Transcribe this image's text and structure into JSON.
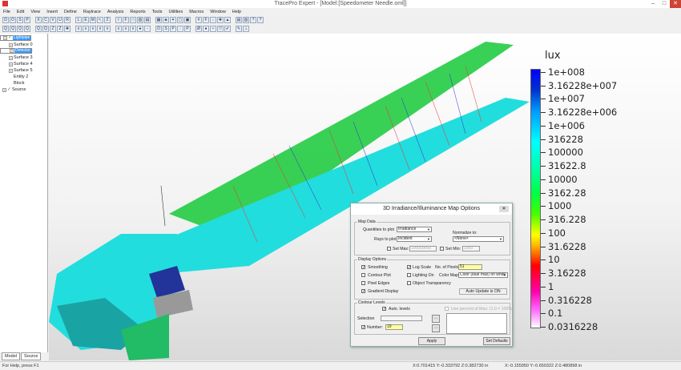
{
  "window": {
    "title": "TracePro Expert - [Model:[Speedometer Needle.oml]]",
    "minimize": "–",
    "maximize": "□",
    "close": "✕"
  },
  "menu": [
    "File",
    "Edit",
    "View",
    "Insert",
    "Define",
    "Raytrace",
    "Analysis",
    "Reports",
    "Tools",
    "Utilities",
    "Macros",
    "Window",
    "Help"
  ],
  "toolbar1": [
    "D",
    "O",
    "S",
    "P",
    "X",
    "C",
    "V",
    "U",
    "R",
    "L",
    "E",
    "M",
    "↖",
    "Z",
    "I",
    "F",
    "□",
    "▥",
    "▤",
    "▦",
    "◈",
    "✦",
    "▢",
    "▣",
    "#",
    "F",
    "↓",
    "✚",
    "▲",
    "▤",
    "▥",
    "?",
    "?"
  ],
  "toolbar2": [
    "Q",
    "Q",
    "Q",
    "Q",
    "Q",
    "Q",
    "Z",
    "Z",
    "✚",
    "x",
    "x",
    "x",
    "x",
    "x",
    "x",
    "x",
    "x",
    "●",
    "-",
    "D",
    "S",
    "P",
    ":",
    "P",
    "Ø",
    "●",
    "•",
    "▽",
    "✔",
    "✎",
    "⊥"
  ],
  "tree": [
    {
      "label": "Lightpipe",
      "expander": "+",
      "checked": true,
      "selected": true,
      "indent": 0
    },
    {
      "label": "Detector",
      "expander": "-",
      "checked": true,
      "selected": false,
      "indent": 0
    },
    {
      "label": "Surface 0",
      "expander": "+",
      "checked": false,
      "selected": false,
      "indent": 1
    },
    {
      "label": "Detector",
      "expander": "+",
      "checked": false,
      "selected": true,
      "indent": 1
    },
    {
      "label": "Surface 2",
      "expander": "+",
      "checked": false,
      "selected": false,
      "indent": 1
    },
    {
      "label": "Surface 3",
      "expander": "+",
      "checked": false,
      "selected": false,
      "indent": 1
    },
    {
      "label": "Surface 4",
      "expander": "+",
      "checked": false,
      "selected": false,
      "indent": 1
    },
    {
      "label": "Surface 5",
      "expander": "+",
      "checked": false,
      "selected": false,
      "indent": 1
    },
    {
      "label": "Entity 2",
      "expander": "",
      "checked": false,
      "selected": false,
      "indent": 1
    },
    {
      "label": "Block",
      "expander": "",
      "checked": false,
      "selected": false,
      "indent": 1
    },
    {
      "label": "Source",
      "expander": "+",
      "checked": true,
      "selected": false,
      "indent": 0
    }
  ],
  "tabs": [
    "Model",
    "Source"
  ],
  "legend": {
    "unit": "lux",
    "labels": [
      "1e+008",
      "3.16228e+007",
      "1e+007",
      "3.16228e+006",
      "1e+006",
      "316228",
      "100000",
      "31622.8",
      "10000",
      "3162.28",
      "1000",
      "316.228",
      "100",
      "31.6228",
      "10",
      "3.16228",
      "1",
      "0.316228",
      "0.1",
      "0.0316228"
    ],
    "scale": "log",
    "colors": [
      "#0000ff",
      "#00ffff",
      "#00ff00",
      "#ffff00",
      "#ff0000",
      "#ff00ff",
      "#ffffff"
    ]
  },
  "dialog": {
    "title": "3D Irradiance/Illuminance Map Options",
    "close": "✕",
    "map_data": {
      "label": "Map Data",
      "quantities_label": "Quantities to plot",
      "quantities_value": "Irradiance",
      "rays_label": "Rays to plot",
      "rays_value": "Incident",
      "normalize_label": "Normalize to:",
      "normalize_value": "<None>",
      "set_max_label": "Set Max:",
      "set_max_value": "100000000",
      "set_min_label": "Set Min:",
      "set_min_value": "1000"
    },
    "display": {
      "label": "Display Options",
      "smoothing": "Smoothing",
      "contour_plot": "Contour Plot",
      "pixel_edges": "Pixel Edges",
      "gradient_display": "Gradient Display",
      "log_scale": "Log Scale",
      "lighting_on": "Lighting On",
      "object_transparency": "Object Transparency",
      "pixels_label": "No. of Pixels:",
      "pixels_value": "51",
      "color_map_label": "Color Map:",
      "color_map_value": "Color (blue max) on white",
      "auto_update": "Auto Update is ON"
    },
    "contour": {
      "label": "Contour Levels",
      "auto_levels": "Auto. levels",
      "use_percent": "Use percent of Max: (1.0 = 100%)",
      "selection_label": "Selection",
      "number_label": "Number:",
      "number_value": "19",
      "add": "<<",
      "remove": ">>"
    },
    "apply": "Apply",
    "set_defaults": "Set Defaults"
  },
  "status": {
    "help": "For Help, press F1",
    "coord1": "X:0.701415 Y:-0.333792 Z:0.382730 in",
    "coord2": "X:-0.155950 Y:-0.650322 Z:0.480898 in"
  }
}
